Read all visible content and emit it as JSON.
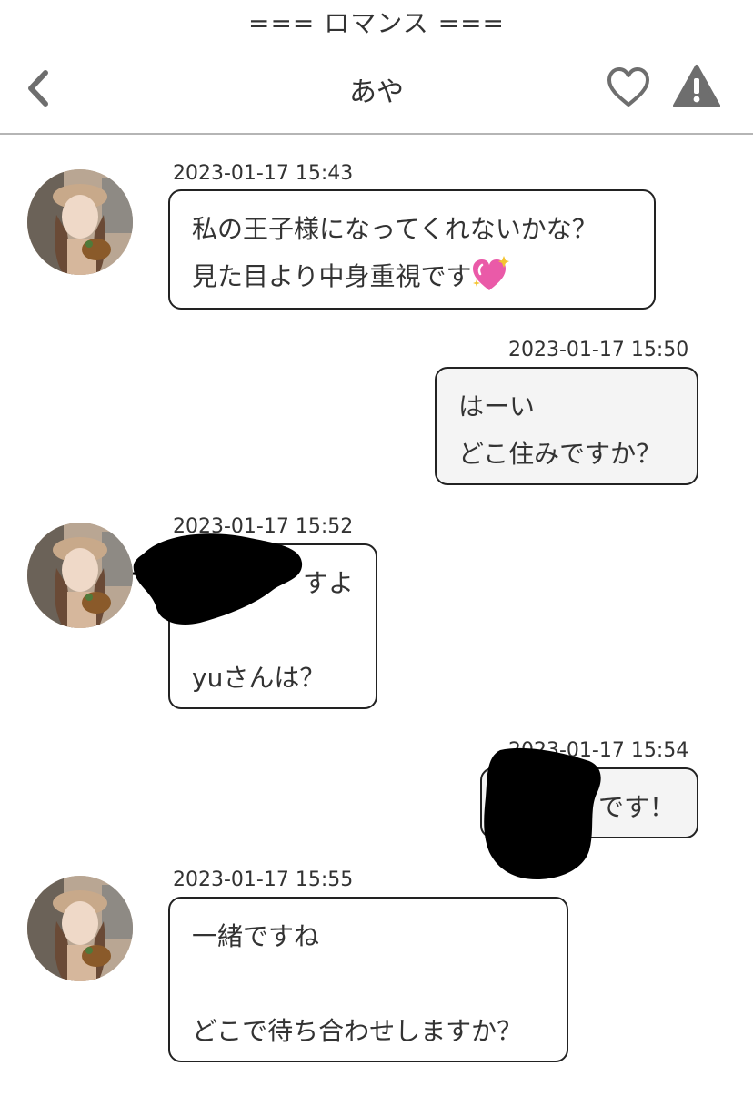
{
  "app": {
    "banner": "=== ロマンス ==="
  },
  "header": {
    "title": "あや",
    "back_icon": "chevron-left-icon",
    "favorite_icon": "heart-outline-icon",
    "report_icon": "warning-triangle-icon"
  },
  "messages": [
    {
      "sender": "partner",
      "timestamp": "2023-01-17 15:43",
      "lines": [
        "私の王子様になってくれないかな？",
        "見た目より中身重視です"
      ],
      "emoji": "sparkling-heart-icon"
    },
    {
      "sender": "me",
      "timestamp": "2023-01-17 15:50",
      "lines": [
        "はーい",
        "どこ住みですか？"
      ]
    },
    {
      "sender": "partner",
      "timestamp": "2023-01-17 15:52",
      "lines": [
        "すよ",
        "",
        "yuさんは？"
      ],
      "redacted": true
    },
    {
      "sender": "me",
      "timestamp": "2023-01-17 15:54",
      "lines": [
        "です！"
      ],
      "redacted": true
    },
    {
      "sender": "partner",
      "timestamp": "2023-01-17 15:55",
      "lines": [
        "一緒ですね",
        "",
        "どこで待ち合わせしますか？"
      ]
    }
  ],
  "colors": {
    "icon_gray": "#6e6e6e",
    "bubble_border": "#222222",
    "my_bubble_bg": "#f4f4f4",
    "divider": "#b5b5b5",
    "redaction": "#000000"
  }
}
